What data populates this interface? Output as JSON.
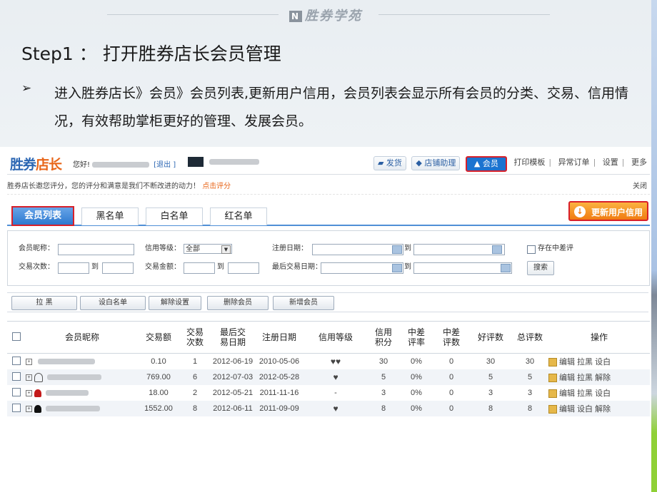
{
  "slide": {
    "brand": "胜券学苑",
    "brand_logo": "N",
    "title": "Step1 ： 打开胜券店长会员管理",
    "bullet_symbol": "➢",
    "body": "进入胜券店长》会员》会员列表,更新用户信用，会员列表会显示所有会员的分类、交易、信用情况，有效帮助掌柜更好的管理、发展会员。"
  },
  "app": {
    "logo_blue": "胜券",
    "logo_orange": "店长",
    "greeting": "您好!",
    "logout": "[退出 ]",
    "nav": {
      "ship": "发货",
      "shop_helper": "店铺助理",
      "member": "会员",
      "print_template": "打印模板",
      "abnormal_orders": "异常订单",
      "settings": "设置",
      "more": "更多"
    },
    "notice": {
      "text": "胜券店长邀您评分，您的评分和满意是我们不断改进的动力！",
      "link": "点击评分",
      "close": "关闭"
    },
    "tabs": [
      "会员列表",
      "黑名单",
      "白名单",
      "红名单"
    ],
    "update_button": "更新用户信用",
    "search": {
      "nickname_label": "会员昵称：",
      "credit_level_label": "信用等级：",
      "credit_level_value": "全部",
      "reg_date_label": "注册日期：",
      "to": "到",
      "has_neutral_label": "存在中差评",
      "trade_count_label": "交易次数：",
      "trade_amount_label": "交易金额：",
      "last_trade_date_label": "最后交易日期：",
      "search_button": "搜索"
    },
    "actions": [
      "拉 黑",
      "设白名单",
      "解除设置",
      "删除会员",
      "新增会员"
    ],
    "table": {
      "headers": [
        "会员昵称",
        "交易额",
        "交易次数",
        "最后交易日期",
        "注册日期",
        "信用等级",
        "信用积分",
        "中差评率",
        "中差评数",
        "好评数",
        "总评数",
        "操作"
      ],
      "rows": [
        {
          "amount": "0.10",
          "count": "1",
          "last": "2012-06-19",
          "reg": "2010-05-06",
          "hearts": "♥♥",
          "score": "30",
          "rate": "0%",
          "neg": "0",
          "good": "30",
          "total": "30",
          "ops": "编辑 拉黑 设白"
        },
        {
          "amount": "769.00",
          "count": "6",
          "last": "2012-07-03",
          "reg": "2012-05-28",
          "hearts": "♥",
          "score": "5",
          "rate": "0%",
          "neg": "0",
          "good": "5",
          "total": "5",
          "ops": "编辑 拉黑 解除"
        },
        {
          "amount": "18.00",
          "count": "2",
          "last": "2012-05-21",
          "reg": "2011-11-16",
          "hearts": "-",
          "score": "3",
          "rate": "0%",
          "neg": "0",
          "good": "3",
          "total": "3",
          "ops": "编辑 拉黑 设白"
        },
        {
          "amount": "1552.00",
          "count": "8",
          "last": "2012-06-11",
          "reg": "2011-09-09",
          "hearts": "♥",
          "score": "8",
          "rate": "0%",
          "neg": "0",
          "good": "8",
          "total": "8",
          "ops": "编辑 设白 解除"
        }
      ]
    }
  },
  "colors": {
    "accent": "#1b73d0",
    "highlight": "#d8202a",
    "orange": "#f07b12"
  }
}
